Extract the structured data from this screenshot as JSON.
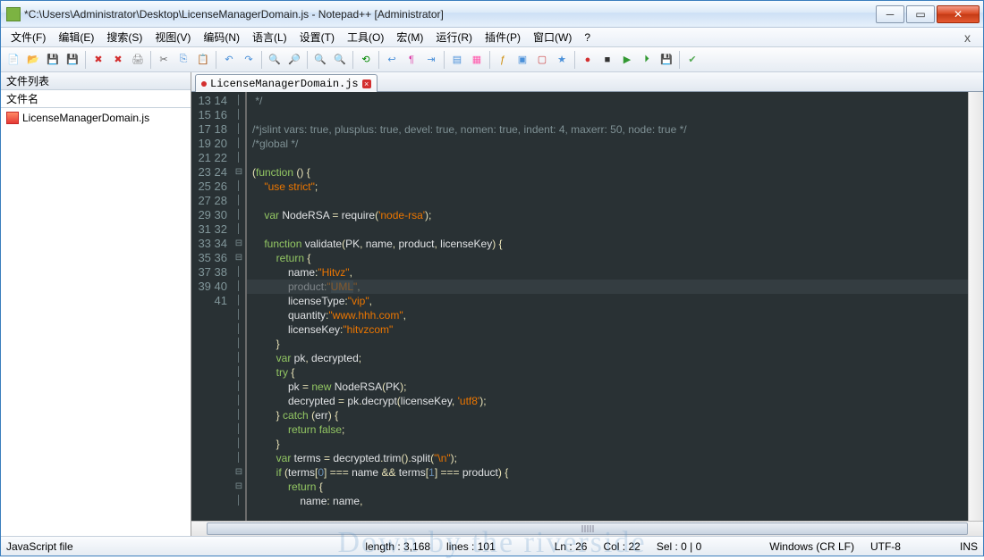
{
  "title": "*C:\\Users\\Administrator\\Desktop\\LicenseManagerDomain.js - Notepad++ [Administrator]",
  "menus": [
    "文件(F)",
    "编辑(E)",
    "搜索(S)",
    "视图(V)",
    "编码(N)",
    "语言(L)",
    "设置(T)",
    "工具(O)",
    "宏(M)",
    "运行(R)",
    "插件(P)",
    "窗口(W)",
    "?"
  ],
  "side_header": "文件列表",
  "side_sub": "文件名",
  "file_item": "LicenseManagerDomain.js",
  "tab_label": "LicenseManagerDomain.js",
  "line_start": 13,
  "fold_marks": {
    "18": "⊟",
    "23": "⊟",
    "24": "⊟",
    "39": "⊟",
    "40": "⊟"
  },
  "code_lines": [
    {
      "t": " */",
      "cls": "c-cm"
    },
    {
      "t": ""
    },
    {
      "t": "/*jslint vars: true, plusplus: true, devel: true, nomen: true, indent: 4, maxerr: 50, node: true */",
      "cls": "c-cm"
    },
    {
      "t": "/*global */",
      "cls": "c-cm"
    },
    {
      "t": ""
    },
    {
      "html": "<span class='c-pl'>(</span><span class='c-kw'>function</span> <span class='c-pl'>() {</span>"
    },
    {
      "html": "    <span class='c-st'>\"use strict\"</span><span class='c-pl'>;</span>"
    },
    {
      "t": ""
    },
    {
      "html": "    <span class='c-kw'>var</span> NodeRSA <span class='c-pl'>=</span> require<span class='c-pl'>(</span><span class='c-st'>'node-rsa'</span><span class='c-pl'>);</span>"
    },
    {
      "t": ""
    },
    {
      "html": "    <span class='c-kw'>function</span> validate<span class='c-pl'>(</span>PK<span class='c-pl'>,</span> name<span class='c-pl'>,</span> product<span class='c-pl'>,</span> licenseKey<span class='c-pl'>) {</span>"
    },
    {
      "html": "        <span class='c-kw'>return</span> <span class='c-pl'>{</span>"
    },
    {
      "html": "            name<span class='c-pl'>:</span><span class='c-st'>\"Hitvz\"</span><span class='c-pl'>,</span>"
    },
    {
      "html": "            product<span class='c-pl'>:</span><span class='c-st'>\"<span style='background:#3a4a52'>UML</span>\"</span><span class='c-pl'>,</span>"
    },
    {
      "html": "            licenseType<span class='c-pl'>:</span><span class='c-st'>\"vip\"</span><span class='c-pl'>,</span>"
    },
    {
      "html": "            quantity<span class='c-pl'>:</span><span class='c-st'>\"www.hhh.com\"</span><span class='c-pl'>,</span>"
    },
    {
      "html": "            licenseKey<span class='c-pl'>:</span><span class='c-st'>\"hitvzcom\"</span>"
    },
    {
      "html": "        <span class='c-pl'>}</span>"
    },
    {
      "html": "        <span class='c-kw'>var</span> pk<span class='c-pl'>,</span> decrypted<span class='c-pl'>;</span>"
    },
    {
      "html": "        <span class='c-kw'>try</span> <span class='c-pl'>{</span>"
    },
    {
      "html": "            pk <span class='c-pl'>=</span> <span class='c-kw'>new</span> NodeRSA<span class='c-pl'>(</span>PK<span class='c-pl'>);</span>"
    },
    {
      "html": "            decrypted <span class='c-pl'>=</span> pk<span class='c-pl'>.</span>decrypt<span class='c-pl'>(</span>licenseKey<span class='c-pl'>,</span> <span class='c-st'>'utf8'</span><span class='c-pl'>);</span>"
    },
    {
      "html": "        <span class='c-pl'>}</span> <span class='c-kw'>catch</span> <span class='c-pl'>(</span>err<span class='c-pl'>) {</span>"
    },
    {
      "html": "            <span class='c-kw'>return false</span><span class='c-pl'>;</span>"
    },
    {
      "html": "        <span class='c-pl'>}</span>"
    },
    {
      "html": "        <span class='c-kw'>var</span> terms <span class='c-pl'>=</span> decrypted<span class='c-pl'>.</span>trim<span class='c-pl'>().</span>split<span class='c-pl'>(</span><span class='c-st'>\"\\n\"</span><span class='c-pl'>);</span>"
    },
    {
      "html": "        <span class='c-kw'>if</span> <span class='c-pl'>(</span>terms<span class='c-pl'>[</span><span class='c-bl'>0</span><span class='c-pl'>] ===</span> name <span class='c-pl'>&amp;&amp;</span> terms<span class='c-pl'>[</span><span class='c-bl'>1</span><span class='c-pl'>] ===</span> product<span class='c-pl'>) {</span>"
    },
    {
      "html": "            <span class='c-kw'>return</span> <span class='c-pl'>{</span>"
    },
    {
      "html": "                name<span class='c-pl'>:</span> name<span class='c-pl'>,</span>"
    }
  ],
  "status": {
    "lang": "JavaScript file",
    "length": "length : 3,168",
    "lines": "lines : 101",
    "ln": "Ln : 26",
    "col": "Col : 22",
    "sel": "Sel : 0 | 0",
    "eol": "Windows (CR LF)",
    "enc": "UTF-8",
    "ins": "INS"
  },
  "watermark": "Down by the riverside"
}
